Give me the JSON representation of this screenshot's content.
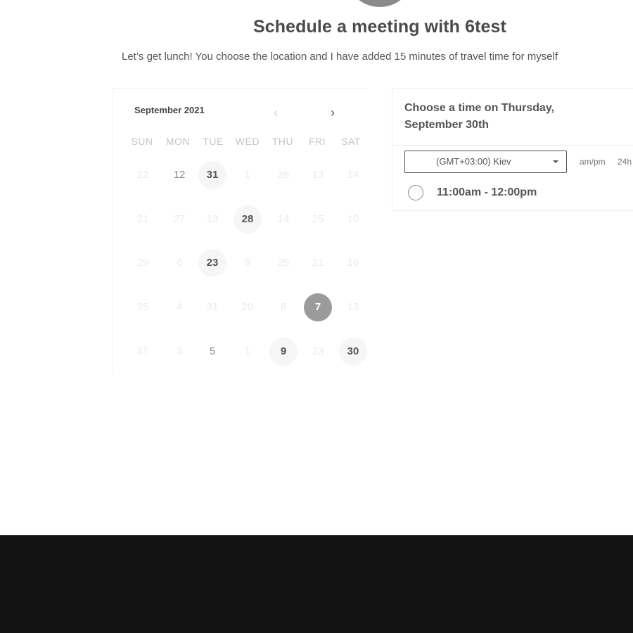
{
  "header": {
    "title": "Schedule a meeting with 6test",
    "subtitle": "Let’s get lunch! You choose the location and I have added 15 minutes of travel time for myself"
  },
  "calendar": {
    "month": "September 2021",
    "weekdays": [
      "SUN",
      "MON",
      "TUE",
      "WED",
      "THU",
      "FRI",
      "SAT"
    ],
    "weeks": [
      [
        {
          "d": "22",
          "s": "dim"
        },
        {
          "d": "12",
          "s": "avail"
        },
        {
          "d": "31",
          "s": "bold"
        },
        {
          "d": "1",
          "s": "dim"
        },
        {
          "d": "26",
          "s": "dim"
        },
        {
          "d": "13",
          "s": "dim"
        },
        {
          "d": "14",
          "s": "dim"
        }
      ],
      [
        {
          "d": "21",
          "s": "dim"
        },
        {
          "d": "27",
          "s": "dim"
        },
        {
          "d": "13",
          "s": "dim"
        },
        {
          "d": "28",
          "s": "bold"
        },
        {
          "d": "14",
          "s": "dim"
        },
        {
          "d": "25",
          "s": "dim"
        },
        {
          "d": "10",
          "s": "dim"
        }
      ],
      [
        {
          "d": "29",
          "s": "dim"
        },
        {
          "d": "6",
          "s": "dim"
        },
        {
          "d": "23",
          "s": "bold"
        },
        {
          "d": "9",
          "s": "dim"
        },
        {
          "d": "25",
          "s": "dim"
        },
        {
          "d": "21",
          "s": "dim"
        },
        {
          "d": "16",
          "s": "dim"
        }
      ],
      [
        {
          "d": "25",
          "s": "dim"
        },
        {
          "d": "4",
          "s": "dim"
        },
        {
          "d": "31",
          "s": "dim"
        },
        {
          "d": "20",
          "s": "dim"
        },
        {
          "d": "8",
          "s": "dim"
        },
        {
          "d": "7",
          "s": "selected"
        },
        {
          "d": "13",
          "s": "dim"
        }
      ],
      [
        {
          "d": "31",
          "s": "dim"
        },
        {
          "d": "3",
          "s": "dim"
        },
        {
          "d": "5",
          "s": "avail"
        },
        {
          "d": "1",
          "s": "dim"
        },
        {
          "d": "9",
          "s": "bold"
        },
        {
          "d": "23",
          "s": "dim"
        },
        {
          "d": "30",
          "s": "bold"
        }
      ]
    ]
  },
  "time_panel": {
    "heading": "Choose a time on Thursday, September 30th",
    "timezone": "(GMT+03:00) Kiev",
    "format_ampm": "am/pm",
    "format_24h": "24h",
    "slots": [
      "11:00am - 12:00pm"
    ]
  },
  "colors": {
    "selected_day": "#9b9b9b",
    "footer": "#121212"
  },
  "icons": {
    "prev": "chevron-left-icon",
    "next": "chevron-right-icon",
    "dropdown": "caret-down-icon"
  }
}
